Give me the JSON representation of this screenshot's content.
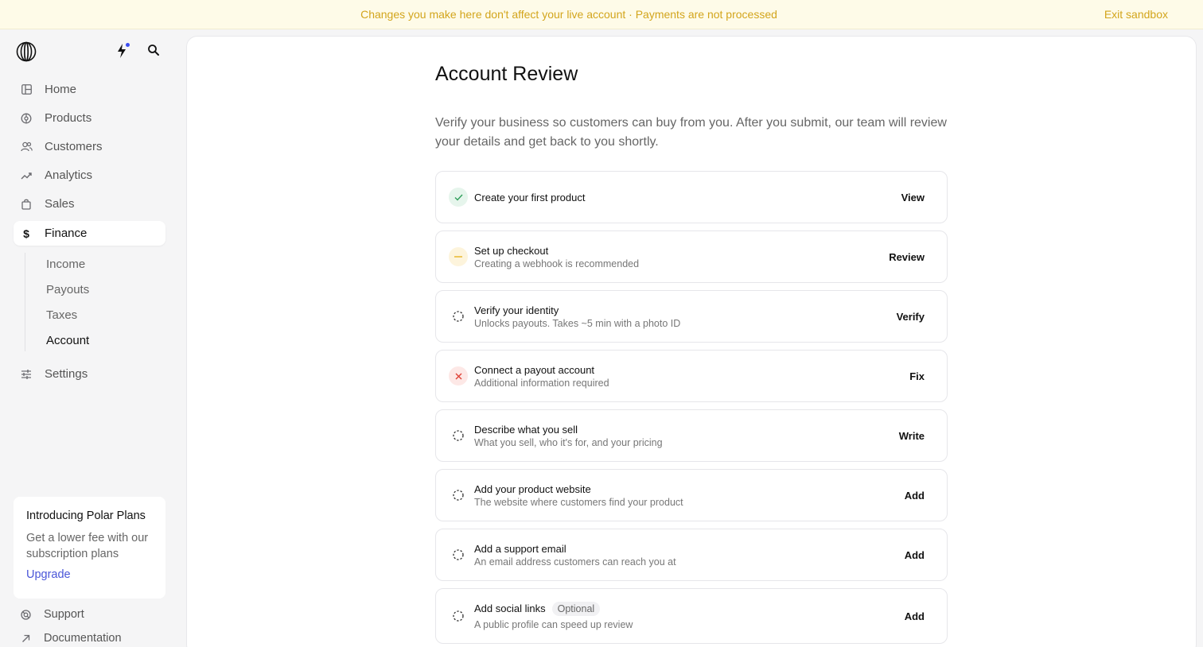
{
  "banner": {
    "message": "Changes you make here don't affect your live account · Payments are not processed",
    "exit_label": "Exit sandbox"
  },
  "sidebar": {
    "logo_icon": "polar-logo-icon",
    "nav": [
      {
        "label": "Home",
        "icon": "layout-icon"
      },
      {
        "label": "Products",
        "icon": "cube-icon"
      },
      {
        "label": "Customers",
        "icon": "users-icon"
      },
      {
        "label": "Analytics",
        "icon": "trend-icon"
      },
      {
        "label": "Sales",
        "icon": "bag-icon"
      },
      {
        "label": "Finance",
        "icon": "dollar-icon"
      }
    ],
    "finance_sub": [
      {
        "label": "Income"
      },
      {
        "label": "Payouts"
      },
      {
        "label": "Taxes"
      },
      {
        "label": "Account"
      }
    ],
    "settings": {
      "label": "Settings",
      "icon": "sliders-icon"
    },
    "promo": {
      "title": "Introducing Polar Plans",
      "description": "Get a lower fee with our subscription plans",
      "link": "Upgrade"
    },
    "footer": [
      {
        "label": "Support",
        "icon": "lifebuoy-icon"
      },
      {
        "label": "Documentation",
        "icon": "arrow-up-right-icon"
      }
    ]
  },
  "main": {
    "title": "Account Review",
    "intro": "Verify your business so customers can buy from you. After you submit, our team will review your details and get back to you shortly.",
    "tasks": [
      {
        "title": "Create your first product",
        "subtitle": "",
        "action": "View",
        "status": "complete"
      },
      {
        "title": "Set up checkout",
        "subtitle": "Creating a webhook is recommended",
        "action": "Review",
        "status": "warning"
      },
      {
        "title": "Verify your identity",
        "subtitle": "Unlocks payouts. Takes ~5 min with a photo ID",
        "action": "Verify",
        "status": "pending"
      },
      {
        "title": "Connect a payout account",
        "subtitle": "Additional information required",
        "action": "Fix",
        "status": "error"
      },
      {
        "title": "Describe what you sell",
        "subtitle": "What you sell, who it's for, and your pricing",
        "action": "Write",
        "status": "pending"
      },
      {
        "title": "Add your product website",
        "subtitle": "The website where customers find your product",
        "action": "Add",
        "status": "pending"
      },
      {
        "title": "Add a support email",
        "subtitle": "An email address customers can reach you at",
        "action": "Add",
        "status": "pending"
      },
      {
        "title": "Add social links",
        "badge": "Optional",
        "subtitle": "A public profile can speed up review",
        "action": "Add",
        "status": "pending"
      }
    ]
  },
  "colors": {
    "banner_bg": "#fefbe8",
    "banner_text": "#d3a51c",
    "success": "#2f9e5a",
    "warning": "#e8b422",
    "error": "#e0453a",
    "link": "#4a56d8"
  }
}
